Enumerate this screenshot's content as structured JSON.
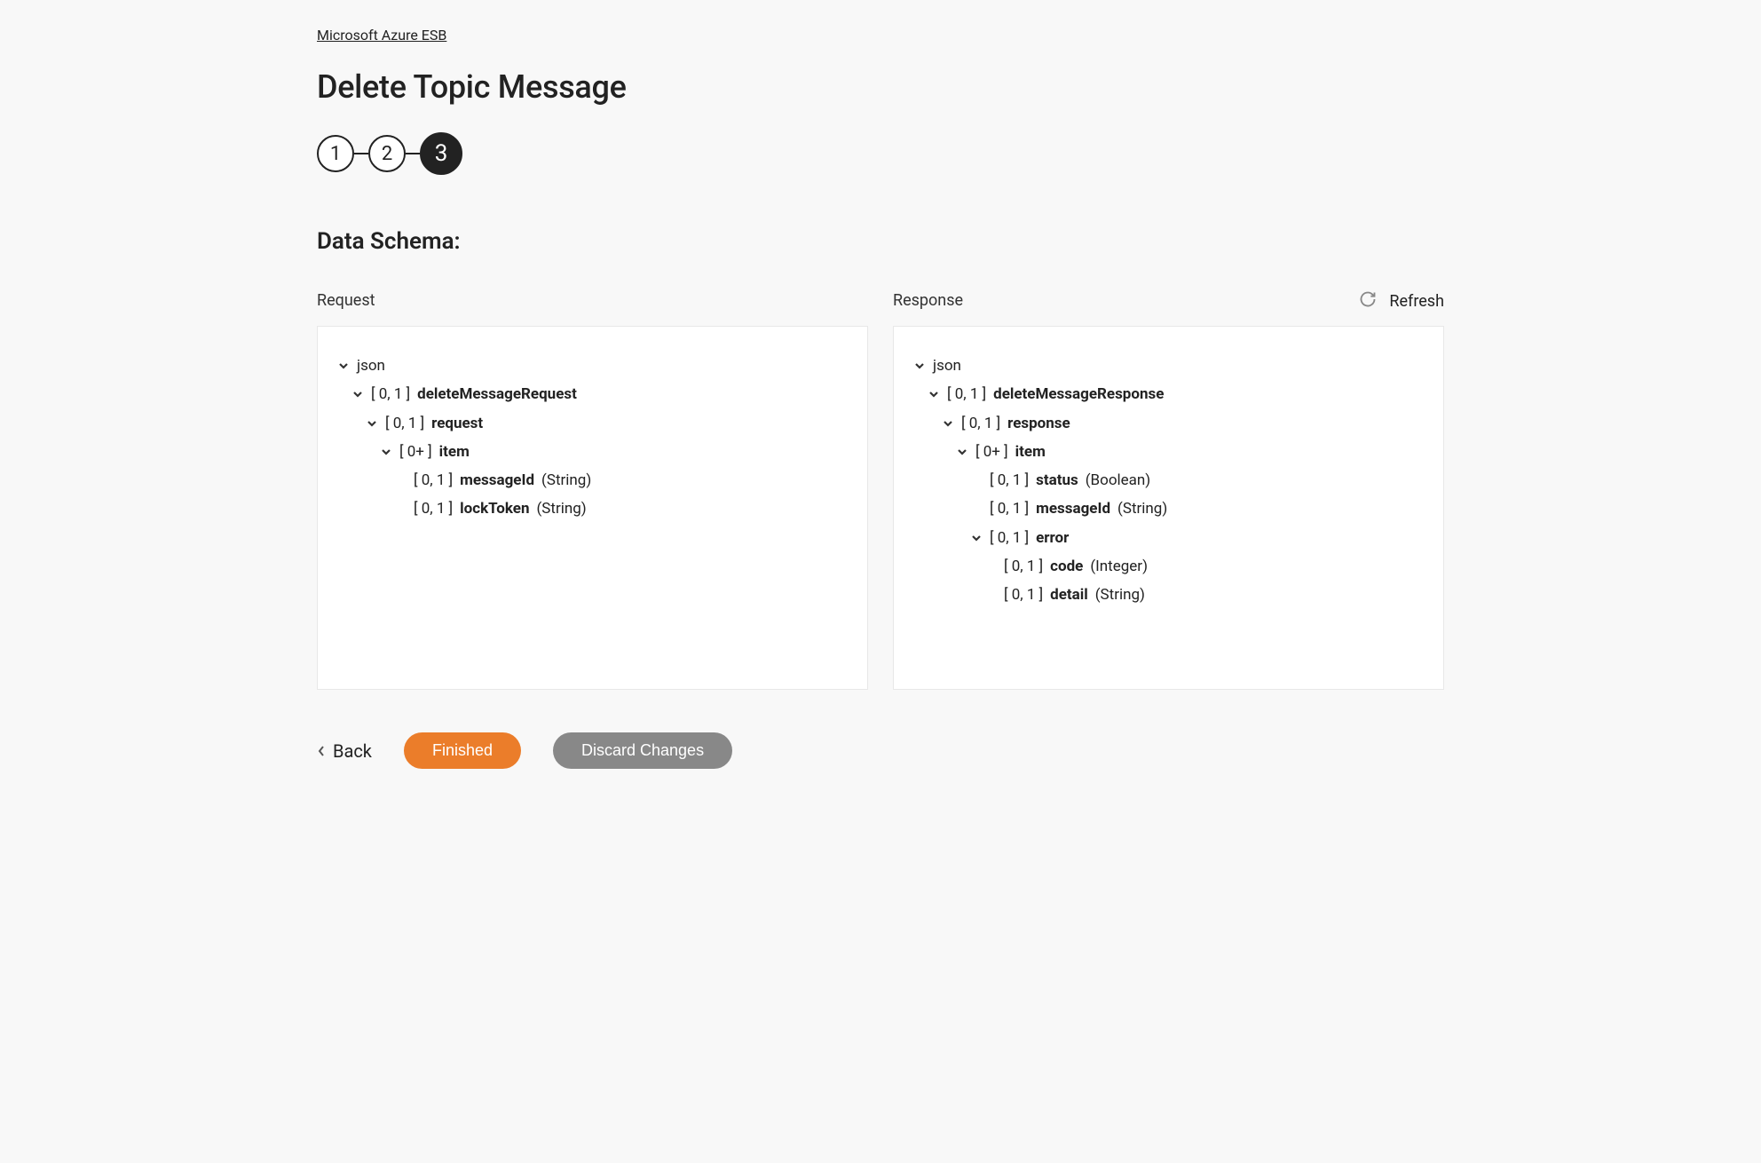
{
  "breadcrumb": "Microsoft Azure ESB",
  "page_title": "Delete Topic Message",
  "steps": [
    "1",
    "2",
    "3"
  ],
  "active_step_index": 2,
  "section_heading": "Data Schema:",
  "refresh_label": "Refresh",
  "panels": {
    "request": {
      "heading": "Request",
      "root": "json",
      "l1_card": "[ 0, 1 ]",
      "l1_name": "deleteMessageRequest",
      "l2_card": "[ 0, 1 ]",
      "l2_name": "request",
      "l3_card": "[ 0+ ]",
      "l3_name": "item",
      "leaf1_card": "[ 0, 1 ]",
      "leaf1_name": "messageId",
      "leaf1_type": "(String)",
      "leaf2_card": "[ 0, 1 ]",
      "leaf2_name": "lockToken",
      "leaf2_type": "(String)"
    },
    "response": {
      "heading": "Response",
      "root": "json",
      "l1_card": "[ 0, 1 ]",
      "l1_name": "deleteMessageResponse",
      "l2_card": "[ 0, 1 ]",
      "l2_name": "response",
      "l3_card": "[ 0+ ]",
      "l3_name": "item",
      "leaf1_card": "[ 0, 1 ]",
      "leaf1_name": "status",
      "leaf1_type": "(Boolean)",
      "leaf2_card": "[ 0, 1 ]",
      "leaf2_name": "messageId",
      "leaf2_type": "(String)",
      "err_card": "[ 0, 1 ]",
      "err_name": "error",
      "err_l1_card": "[ 0, 1 ]",
      "err_l1_name": "code",
      "err_l1_type": "(Integer)",
      "err_l2_card": "[ 0, 1 ]",
      "err_l2_name": "detail",
      "err_l2_type": "(String)"
    }
  },
  "footer": {
    "back": "Back",
    "finished": "Finished",
    "discard": "Discard Changes"
  }
}
